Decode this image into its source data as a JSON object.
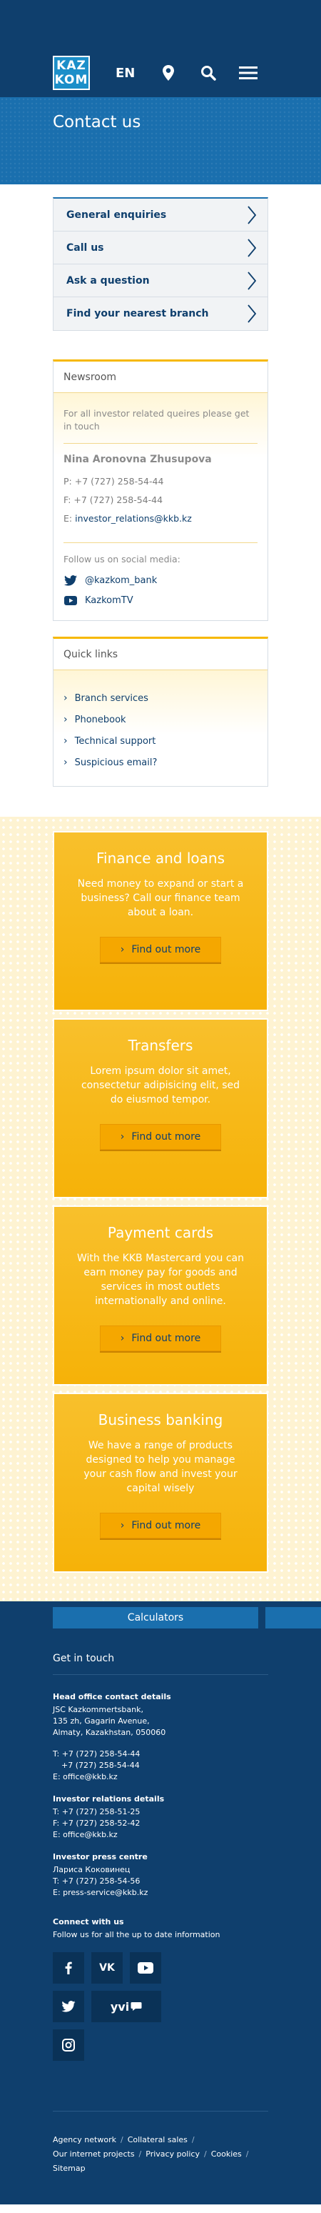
{
  "header": {
    "logo_line1": "KAZ",
    "logo_line2": "KOM",
    "lang": "EN"
  },
  "page_title": "Contact us",
  "accordion": [
    {
      "label": "General enquiries"
    },
    {
      "label": "Call us"
    },
    {
      "label": "Ask a question"
    },
    {
      "label": "Find your nearest branch"
    }
  ],
  "newsroom": {
    "title": "Newsroom",
    "intro": "For all investor related queires please get in touch",
    "name": "Nina Aronovna Zhusupova",
    "phone": "P: +7 (727) 258-54-44",
    "fax": "F: +7 (727) 258-54-44",
    "email_prefix": "E: ",
    "email": "investor_relations@kkb.kz",
    "follow": "Follow us on social media:",
    "twitter": "@kazkom_bank",
    "youtube": "KazkomTV"
  },
  "quick_links": {
    "title": "Quick links",
    "items": [
      "Branch services",
      "Phonebook",
      "Technical support",
      "Suspicious email?"
    ]
  },
  "promos": [
    {
      "title": "Finance and loans",
      "text": "Need money to expand or start a business? Call our finance team about a loan.",
      "button": "Find out more"
    },
    {
      "title": "Transfers",
      "text": "Lorem ipsum dolor sit amet, consectetur adipisicing elit, sed do eiusmod tempor.",
      "button": "Find out more"
    },
    {
      "title": "Payment cards",
      "text": "With the KKB Mastercard you can earn money pay for goods and services in most outlets internationally and online.",
      "button": "Find out more"
    },
    {
      "title": "Business banking",
      "text": "We have a range of products designed to help you manage your cash flow and invest your capital wisely",
      "button": "Find out more"
    }
  ],
  "footer": {
    "calculators": "Calculators",
    "get_in_touch": "Get in touch",
    "head_office": {
      "title": "Head office contact details",
      "lines": [
        "JSC Kazkommertsbank,",
        "135 zh, Gagarin Avenue,",
        "Almaty, Kazakhstan, 050060"
      ],
      "phone1": "T: +7 (727) 258-54-44",
      "phone2": "+7 (727) 258-54-44",
      "email": "E: office@kkb.kz"
    },
    "investor": {
      "title": "Investor relations details",
      "phone": "T: +7 (727) 258-51-25",
      "fax": "F: +7 (727) 258-52-42",
      "email": "E: office@kkb.kz"
    },
    "press": {
      "title": "Investor press centre",
      "name": "Лариса Коковинец",
      "phone": "T: +7 (727) 258-54-56",
      "email": "E: press-service@kkb.kz"
    },
    "connect": {
      "title": "Connect with us",
      "text": "Follow us for all the up to date information"
    },
    "links": [
      "Agency network",
      "Collateral sales",
      "Our internet projects",
      "Privacy policy",
      "Cookies",
      "Sitemap"
    ],
    "separator": "/"
  },
  "colors": {
    "navy": "#0f3f6d",
    "blue": "#1a6fae",
    "yellow": "#f7b800"
  }
}
